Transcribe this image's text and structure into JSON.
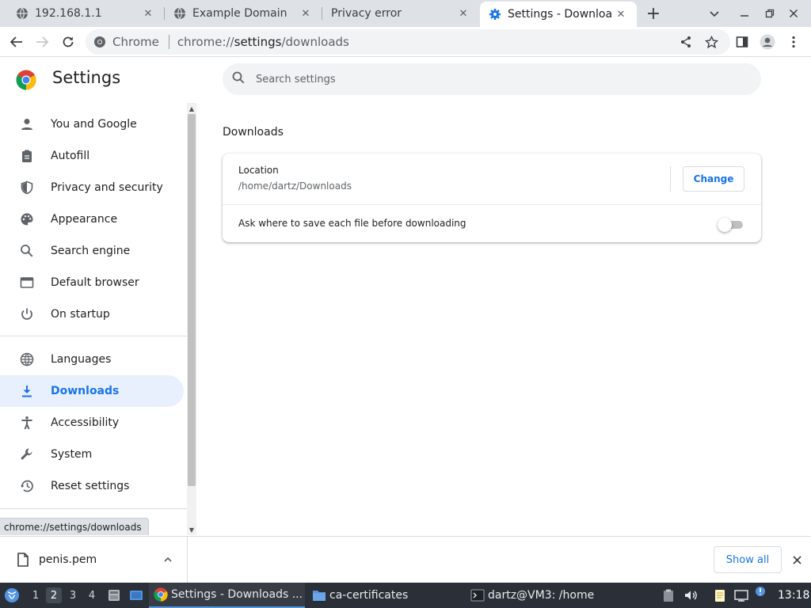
{
  "browser": {
    "tabs": [
      {
        "title": "192.168.1.1",
        "icon": "globe-icon",
        "active": false
      },
      {
        "title": "Example Domain",
        "icon": "globe-icon",
        "active": false
      },
      {
        "title": "Privacy error",
        "icon": "",
        "active": false
      },
      {
        "title": "Settings - Downloads",
        "icon": "settings-gear-icon",
        "active": true
      }
    ],
    "new_tab": "+",
    "omnibox": {
      "chip": "Chrome",
      "url_prefix": "chrome://",
      "url_host": "settings",
      "url_path": "/downloads"
    }
  },
  "settings": {
    "title": "Settings",
    "search_placeholder": "Search settings",
    "nav": [
      {
        "label": "You and Google",
        "icon": "person-icon"
      },
      {
        "label": "Autofill",
        "icon": "clipboard-icon"
      },
      {
        "label": "Privacy and security",
        "icon": "shield-icon"
      },
      {
        "label": "Appearance",
        "icon": "palette-icon"
      },
      {
        "label": "Search engine",
        "icon": "search-icon"
      },
      {
        "label": "Default browser",
        "icon": "browser-window-icon"
      },
      {
        "label": "On startup",
        "icon": "power-icon"
      },
      {
        "label": "Languages",
        "icon": "globe-icon"
      },
      {
        "label": "Downloads",
        "icon": "download-icon",
        "selected": true
      },
      {
        "label": "Accessibility",
        "icon": "accessibility-icon"
      },
      {
        "label": "System",
        "icon": "wrench-icon"
      },
      {
        "label": "Reset settings",
        "icon": "history-icon"
      }
    ],
    "section_title": "Downloads",
    "location_label": "Location",
    "location_path": "/home/dartz/Downloads",
    "change_button": "Change",
    "ask_label": "Ask where to save each file before downloading",
    "ask_enabled": false
  },
  "status_bubble": "chrome://settings/downloads",
  "download_shelf": {
    "file_name": "penis.pem",
    "show_all": "Show all"
  },
  "taskbar": {
    "workspaces": [
      "1",
      "2",
      "3",
      "4"
    ],
    "active_workspace": "2",
    "tasks": [
      {
        "label": "Settings - Downloads ...",
        "icon": "chrome-icon",
        "active": true
      },
      {
        "label": "ca-certificates",
        "icon": "folder-icon",
        "active": false
      },
      {
        "label": "dartz@VM3: /home",
        "icon": "terminal-icon",
        "active": false
      }
    ],
    "clock": "13:18"
  },
  "colors": {
    "accent": "#1a73e8",
    "nav_selected_bg": "#e8f0fe",
    "tabstrip_bg": "#dee1e6",
    "taskbar_bg": "#2b3038"
  }
}
